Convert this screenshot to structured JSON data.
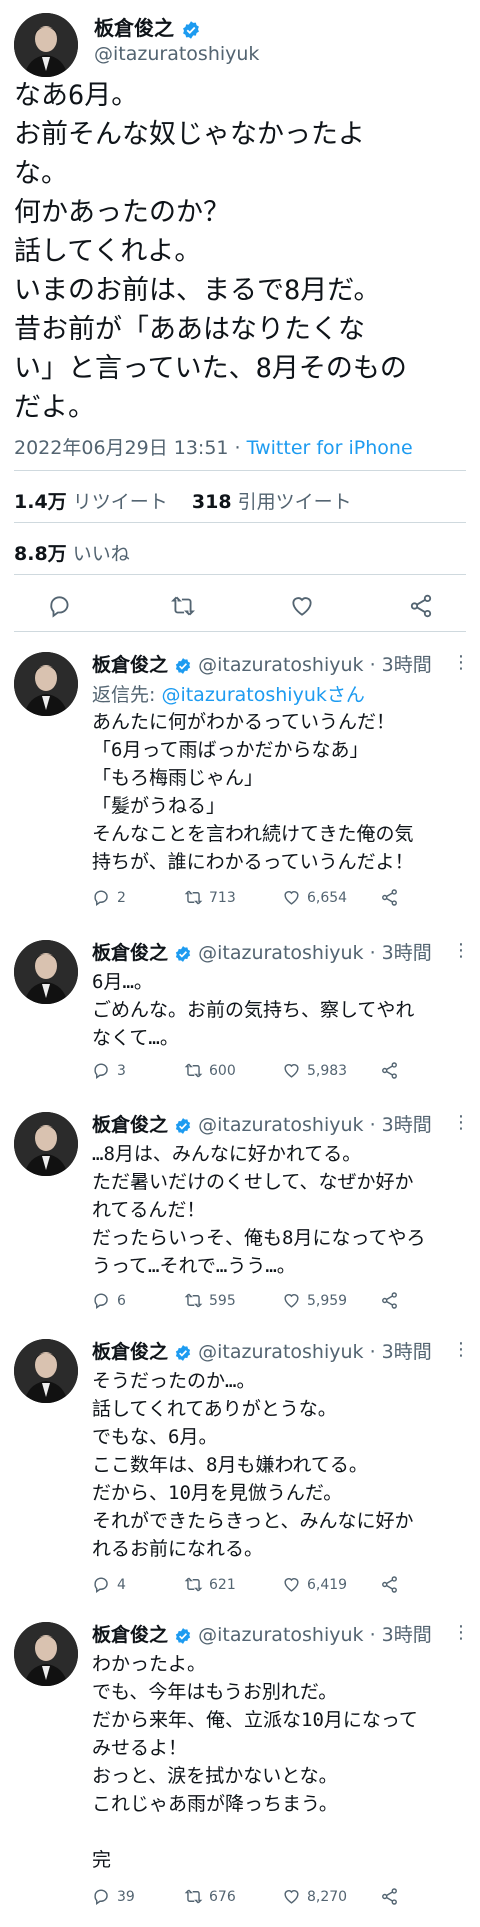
{
  "main": {
    "name": "板倉俊之",
    "handle": "@itazuratoshiyuk",
    "text": "なあ6月。\nお前そんな奴じゃなかったよ\nな。\n何かあったのか？\n話してくれよ。\nいまのお前は、まるで8月だ。\n昔お前が「ああはなりたくな\nい」と言っていた、8月そのもの\nだよ。",
    "timestamp": "2022年06月29日 13:51",
    "separator": " · ",
    "source": "Twitter for iPhone",
    "retweets_count": "1.4万",
    "retweets_label": "リツイート",
    "quotes_count": "318",
    "quotes_label": "引用ツイート",
    "likes_count": "8.8万",
    "likes_label": "いいね"
  },
  "replies": [
    {
      "name": "板倉俊之",
      "handle": "@itazuratoshiyuk",
      "time": "· 3時間",
      "reply_to_prefix": "返信先: ",
      "reply_to_handle": "@itazuratoshiyukさん",
      "text": "あんたに何がわかるっていうんだ！\n「6月って雨ばっかだからなあ」\n「もろ梅雨じゃん」\n「髪がうねる」\nそんなことを言われ続けてきた俺の気\n持ちが、誰にわかるっていうんだよ！",
      "replies": "2",
      "retweets": "713",
      "likes": "6,654"
    },
    {
      "name": "板倉俊之",
      "handle": "@itazuratoshiyuk",
      "time": "· 3時間",
      "text": "6月…。\nごめんな。お前の気持ち、察してやれ\nなくて…。",
      "replies": "3",
      "retweets": "600",
      "likes": "5,983"
    },
    {
      "name": "板倉俊之",
      "handle": "@itazuratoshiyuk",
      "time": "· 3時間",
      "text": "…8月は、みんなに好かれてる。\nただ暑いだけのくせして、なぜか好か\nれてるんだ！\nだったらいっそ、俺も8月になってやろ\nうって…それで…うう…。",
      "replies": "6",
      "retweets": "595",
      "likes": "5,959"
    },
    {
      "name": "板倉俊之",
      "handle": "@itazuratoshiyuk",
      "time": "· 3時間",
      "text": "そうだったのか…。\n話してくれてありがとうな。\nでもな、6月。\nここ数年は、8月も嫌われてる。\nだから、10月を見倣うんだ。\nそれができたらきっと、みんなに好か\nれるお前になれる。",
      "replies": "4",
      "retweets": "621",
      "likes": "6,419"
    },
    {
      "name": "板倉俊之",
      "handle": "@itazuratoshiyuk",
      "time": "· 3時間",
      "text": "わかったよ。\nでも、今年はもうお別れだ。\nだから来年、俺、立派な10月になって\nみせるよ！\nおっと、涙を拭かないとな。\nこれじゃあ雨が降っちまう。\n\n完",
      "replies": "39",
      "retweets": "676",
      "likes": "8,270"
    }
  ],
  "colors": {
    "accent": "#1d9bf0",
    "muted": "#536471",
    "text": "#0f1419",
    "border": "#cfd9de"
  },
  "icons": [
    "verified-badge-icon",
    "reply-icon",
    "retweet-icon",
    "like-icon",
    "share-icon",
    "more-icon"
  ]
}
